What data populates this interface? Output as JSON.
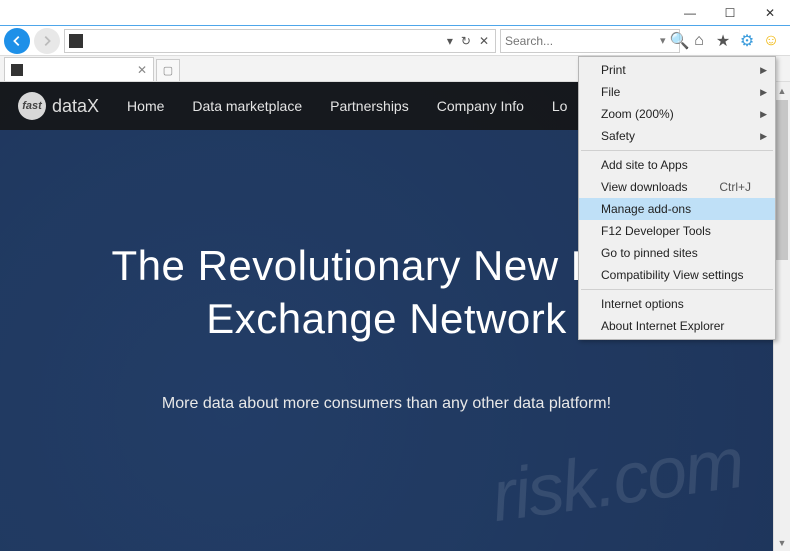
{
  "window": {
    "min": "—",
    "max": "☐",
    "close": "✕"
  },
  "nav": {
    "address_value": "",
    "search_placeholder": "Search...",
    "refresh_icon": "↻",
    "dropdown_icon": "▾",
    "stop_icon": "✕",
    "tab_title": "",
    "tab_close": "✕",
    "magnifier": "🔍",
    "star_icon_name": "favorites-icon",
    "home_icon_name": "home-icon"
  },
  "icons": {
    "home": "⌂",
    "star": "★",
    "gear": "⚙",
    "smiley": "☺"
  },
  "menu": {
    "print": "Print",
    "file": "File",
    "zoom": "Zoom (200%)",
    "safety": "Safety",
    "add_site": "Add site to Apps",
    "view_downloads": "View downloads",
    "view_downloads_shortcut": "Ctrl+J",
    "manage_addons": "Manage add-ons",
    "f12": "F12 Developer Tools",
    "pinned": "Go to pinned sites",
    "compat": "Compatibility View settings",
    "inet_opts": "Internet options",
    "about": "About Internet Explorer"
  },
  "site": {
    "logo_badge": "fast",
    "logo_text": "dataX",
    "nav": {
      "home": "Home",
      "marketplace": "Data marketplace",
      "partnerships": "Partnerships",
      "company": "Company Info",
      "login": "Lo"
    },
    "hero_title": "The Revolutionary New Data Exchange Network",
    "hero_sub": "More data about more consumers than any other data platform!"
  },
  "watermark": "risk.com"
}
